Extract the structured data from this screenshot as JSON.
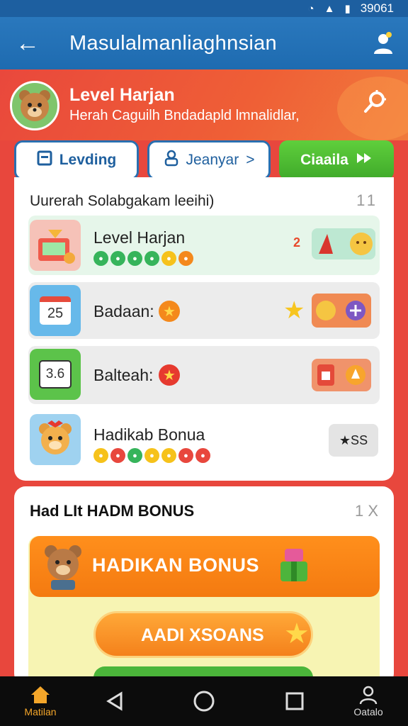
{
  "status_bar": {
    "time": "39061",
    "icons": [
      "wifi-icon",
      "signal-icon",
      "battery-icon"
    ]
  },
  "app_bar": {
    "title": "Masulalmanliaghnsian"
  },
  "hero": {
    "title": "Level Harjan",
    "subtitle": "Herah Caguilh Bndadapld lmnalidlar,"
  },
  "tabs": [
    {
      "label": "Levding",
      "icon": "list-icon"
    },
    {
      "label": "Jeanyar",
      "icon": "person-icon",
      "suffix": ">"
    },
    {
      "label": "Ciaaila",
      "icon": "arrow-icon"
    }
  ],
  "list_card": {
    "heading": "Uurerah Solabgakam leeihi)",
    "count": "11",
    "rows": [
      {
        "label": "Level Harjan",
        "trailing": "2"
      },
      {
        "label": "Badaan:",
        "icon_text": "25"
      },
      {
        "label": "Balteah:",
        "icon_text": "3.6"
      },
      {
        "label": "Hadikab Bonua",
        "trailing": "★SS"
      }
    ]
  },
  "bonus_card": {
    "heading": "Had LIt HADM BONUS",
    "count": "1 X",
    "banner_title": "HADIKAN BONUS",
    "button_label": "AADI XSOANS"
  },
  "nav": {
    "home_label": "Matilan",
    "profile_label": "Oatalo"
  },
  "colors": {
    "app_bar": "#1e6bb0",
    "hero": "#e9483c",
    "accent_green": "#3fa92a",
    "accent_orange": "#f47a10"
  }
}
